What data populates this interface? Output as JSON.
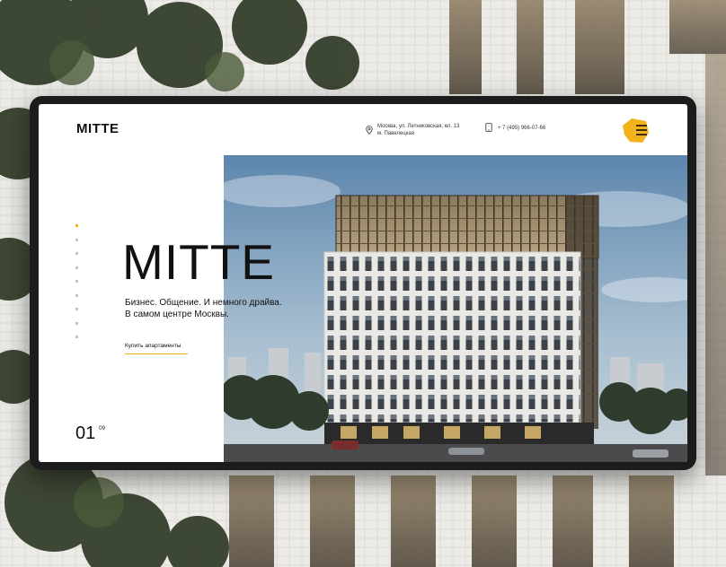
{
  "site": {
    "logo": "MITTE",
    "address_line1": "Москва, ул. Летниковская, вл. 13",
    "address_line2": "м. Павелецкая",
    "phone": "+ 7 (495) 966-07-66"
  },
  "icons": {
    "location": "location-pin-icon",
    "phone": "phone-icon",
    "menu": "menu-hamburger-icon"
  },
  "hero": {
    "title": "MITTE",
    "tagline_line1": "Бизнес. Общение. И немного драйва.",
    "tagline_line2": "В самом центре Москвы.",
    "cta_label": "Купить апартаменты"
  },
  "slider": {
    "current": "01",
    "total": "09",
    "active_index": 0
  },
  "colors": {
    "accent": "#f2b21b",
    "text": "#111111",
    "frame": "#1c1c1c"
  }
}
